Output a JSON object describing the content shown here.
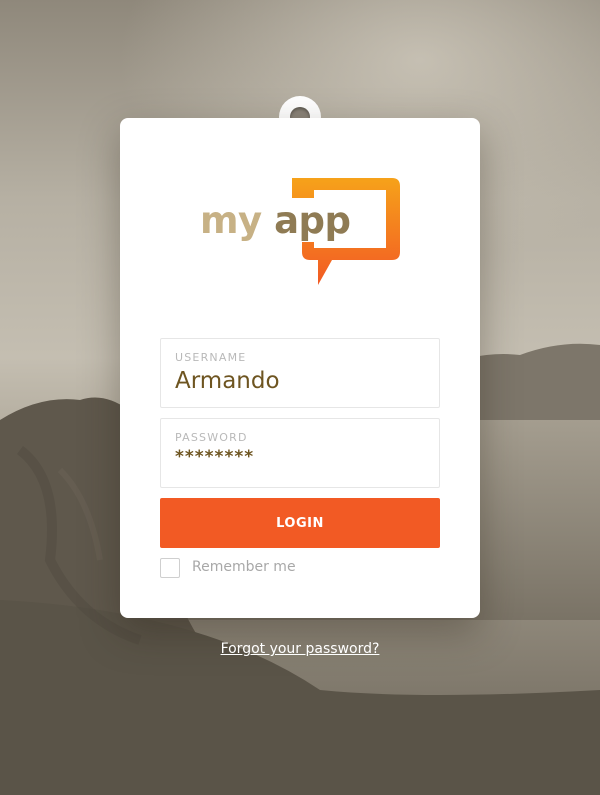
{
  "app": {
    "logo_word_1": "my",
    "logo_word_2": "app",
    "brand_orange": "#f25a24",
    "logo_gradient": [
      "#f6a21a",
      "#f25a24"
    ]
  },
  "login_form": {
    "username": {
      "label": "USERNAME",
      "value": "Armando"
    },
    "password": {
      "label": "PASSWORD",
      "value": "********"
    },
    "login_button_label": "LOGIN",
    "remember_me_label": "Remember me",
    "remember_me_checked": false
  },
  "footer": {
    "forgot_password_link": "Forgot your password?"
  },
  "icons": {
    "logo": "speech-bubble-icon",
    "checkbox": "checkbox-unchecked"
  }
}
